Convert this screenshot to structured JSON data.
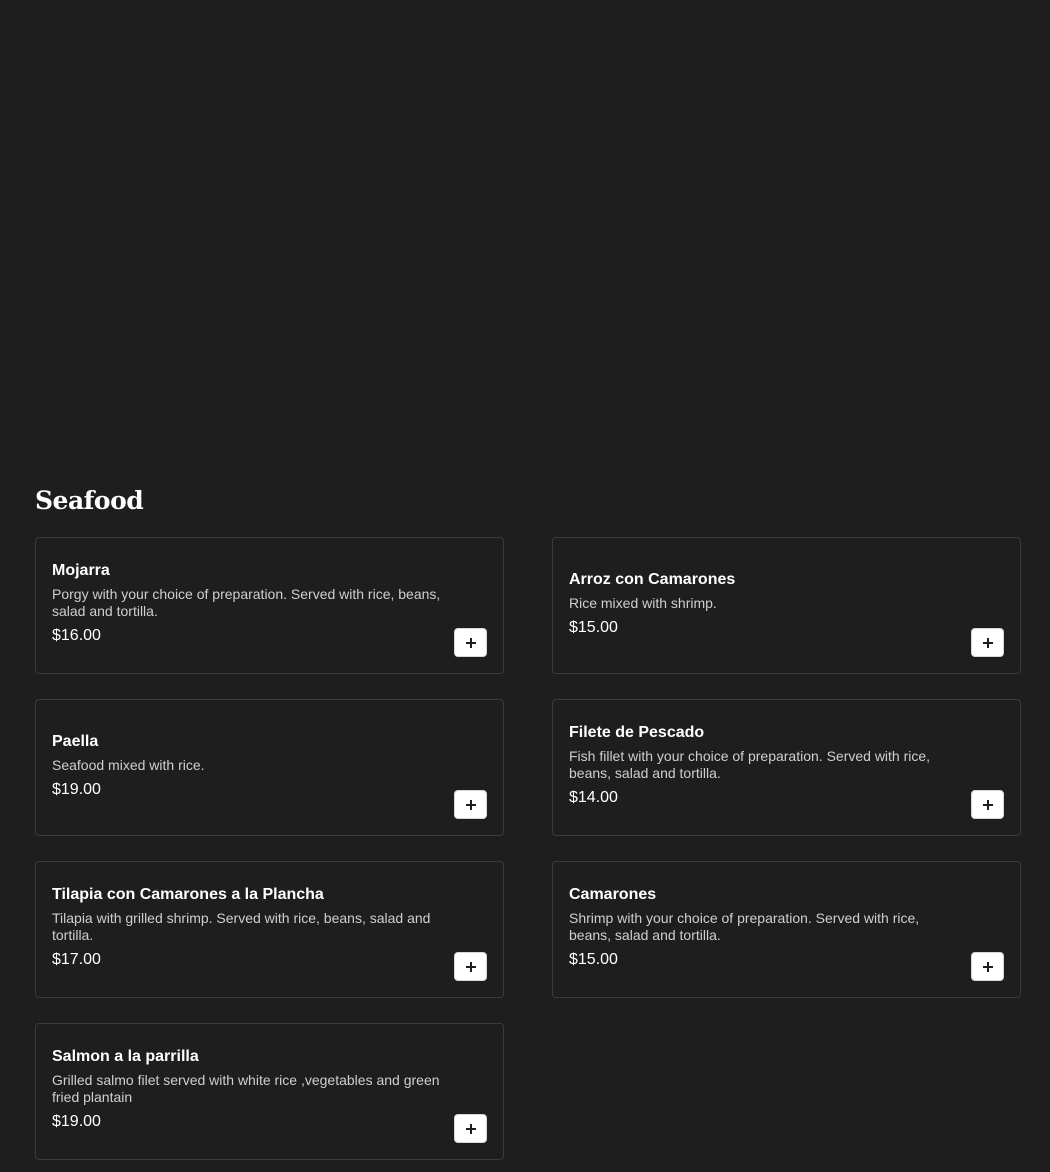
{
  "section": {
    "title": "Seafood"
  },
  "items": [
    {
      "name": "Mojarra",
      "description": "Porgy with your choice of preparation. Served with rice, beans, salad and tortilla.",
      "price": "$16.00",
      "add_icon": "plus-icon"
    },
    {
      "name": "Arroz con Camarones",
      "description": "Rice mixed with shrimp.",
      "price": "$15.00",
      "add_icon": "plus-icon"
    },
    {
      "name": "Paella",
      "description": "Seafood mixed with rice.",
      "price": "$19.00",
      "add_icon": "plus-icon"
    },
    {
      "name": "Filete de Pescado",
      "description": "Fish fillet with your choice of preparation. Served with rice, beans, salad and tortilla.",
      "price": "$14.00",
      "add_icon": "plus-icon"
    },
    {
      "name": "Tilapia con Camarones a la Plancha",
      "description": "Tilapia with grilled shrimp. Served with rice, beans, salad and tortilla.",
      "price": "$17.00",
      "add_icon": "plus-icon"
    },
    {
      "name": "Camarones",
      "description": "Shrimp with your choice of preparation. Served with rice, beans, salad and tortilla.",
      "price": "$15.00",
      "add_icon": "plus-icon"
    },
    {
      "name": "Salmon a la parrilla",
      "description": "Grilled salmo filet served with white rice ,vegetables and green fried plantain",
      "price": "$19.00",
      "add_icon": "plus-icon"
    }
  ],
  "colors": {
    "background": "#1e1e1e",
    "card_border": "#3b3b3b",
    "text_primary": "#ffffff",
    "text_secondary": "#cfcfcf",
    "button_bg": "#ffffff"
  }
}
